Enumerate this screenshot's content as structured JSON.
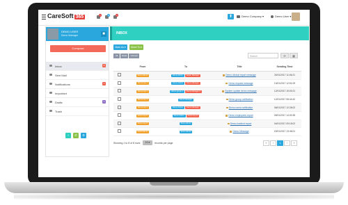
{
  "header": {
    "logo_text": "CareSoft",
    "logo_badge": "365",
    "badges": [
      {
        "count": "1",
        "color": "#e53935"
      },
      {
        "count": "0",
        "color": "#2aa7dd"
      },
      {
        "count": "2",
        "color": "#e53935"
      }
    ],
    "company": "Demo Company",
    "user": "Demo User"
  },
  "sidebar": {
    "profile_name": "DEMO USER",
    "profile_role": "Demo Manager",
    "compose_label": "Compose",
    "folders": [
      {
        "label": "Inbox",
        "count": "8",
        "count_color": "#f0624d"
      },
      {
        "label": "Sent Mail",
        "count": "",
        "count_color": ""
      },
      {
        "label": "Notifications",
        "count": "1",
        "count_color": "#f0624d"
      },
      {
        "label": "Important",
        "count": "",
        "count_color": ""
      },
      {
        "label": "Drafts",
        "count": "1",
        "count_color": "#8e6fc6"
      },
      {
        "label": "Trash",
        "count": "",
        "count_color": ""
      }
    ],
    "tools": [
      {
        "icon": "+",
        "color": "#2fd0c2"
      },
      {
        "icon": "✆",
        "color": "#8bc34a"
      },
      {
        "icon": "⚙",
        "color": "#2aa7dd"
      }
    ]
  },
  "main": {
    "title": "INBOX",
    "mark_as": "Mark As ▾",
    "move_to": "Move To ▾",
    "segments": [
      "All",
      "Read",
      "Unread"
    ],
    "search_placeholder": "Search",
    "columns": [
      "",
      "From",
      "To",
      "Title",
      "Sending Time"
    ],
    "rows": [
      {
        "from": "Demo Admin",
        "to": [
          "Demo Admin",
          "Admin Manager"
        ],
        "title": "Demo clinical report message",
        "time": "30/01/2017 11:06:21"
      },
      {
        "from": "Demo Grp 1",
        "to": [
          "Demo Admin",
          "Demo Manager"
        ],
        "title": "Demo request message",
        "time": "13/01/2017 12:51:09"
      },
      {
        "from": "Demo Grp 2",
        "to": [
          "Admin group 1",
          "Demo Manager 2"
        ],
        "title": "System update demo message",
        "time": "12/01/2017 15:00:21"
      },
      {
        "from": "Demo Grp 3",
        "to": [
          "Demo Manager"
        ],
        "title": "Demo group notification",
        "time": "12/01/2017 08:44:42"
      },
      {
        "from": "Demo Grp 4",
        "to": [
          "Demo Admin",
          "Demo Manager"
        ],
        "title": "Demo users notification",
        "time": "06/01/2017 12:28:02"
      },
      {
        "from": "Demo Grp N",
        "to": [
          "Demo Admin",
          "Demo Grp N"
        ],
        "title": "Demo employees report",
        "time": "05/01/2017 14:00:35"
      },
      {
        "from": "Demo Grp N",
        "to": [
          "Demo Admin"
        ],
        "title": "Demo incident report",
        "time": "04/01/2017 09:18:02"
      },
      {
        "from": "Demo Admin",
        "to": [
          "Demo Admin"
        ],
        "title": "Demo Message",
        "time": "03/01/2017 13:46:01"
      }
    ],
    "footer_info": "Showing 1 to 8 of 8 rows",
    "per_page": "10 ▾",
    "per_page_label": "records per page",
    "pager": [
      "«",
      "‹",
      "1",
      "›",
      "»"
    ]
  },
  "colors": {
    "from_tag": "#f0a02a",
    "to_tag_primary": "#2aa7dd",
    "to_tag_secondary": "#f0624d",
    "header": "#2fd0c2"
  }
}
